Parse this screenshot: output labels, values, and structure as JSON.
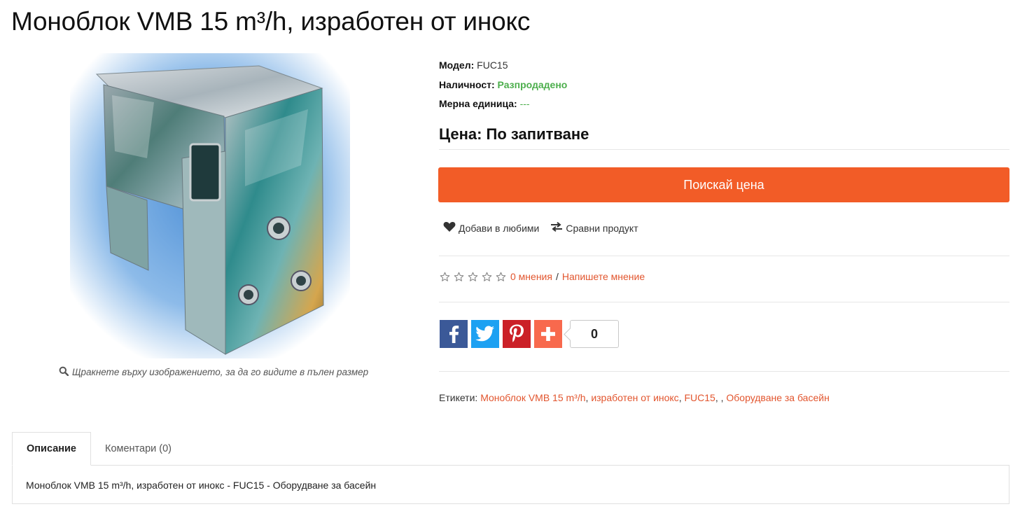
{
  "product": {
    "title": "Моноблок VMB 15 m³/h, изработен от инокс",
    "image_hint": "Щракнете върху изображението, за да го видите в пълен размер"
  },
  "info": {
    "model_label": "Модел:",
    "model_value": "FUC15",
    "availability_label": "Наличност:",
    "availability_value": "Разпродадено",
    "unit_label": "Мерна единица:",
    "unit_value": "---"
  },
  "price": {
    "text": "Цена: По запитване"
  },
  "actions": {
    "ask_price": "Поискай цена",
    "wishlist": "Добави в любими",
    "compare": "Сравни продукт"
  },
  "rating": {
    "stars_filled": 0,
    "stars_total": 5,
    "reviews_link": "0 мнения",
    "separator": "/",
    "write_review_link": "Напишете мнение"
  },
  "share": {
    "count": "0",
    "colors": {
      "facebook": "#3b5998",
      "twitter": "#1da1f2",
      "pinterest": "#cb2027",
      "addthis": "#f8694d"
    }
  },
  "tags": {
    "label": "Етикети:",
    "items": [
      "Моноблок VMB 15 m³/h",
      "изработен от инокс",
      "FUC15",
      "",
      "Оборудване за басейн"
    ]
  },
  "tabs": {
    "items": [
      {
        "label": "Описание"
      },
      {
        "label": "Коментари (0)"
      }
    ],
    "content": "Моноблок VMB 15 m³/h, изработен от инокс - FUC15 - Оборудване за басейн"
  },
  "colors": {
    "accent": "#f25c27",
    "link": "#e2552e",
    "in_stock": "#4cae4c"
  }
}
